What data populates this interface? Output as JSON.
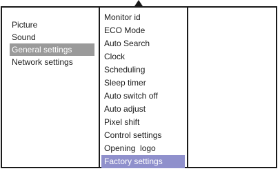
{
  "left_menu": {
    "items": [
      {
        "label": "Picture"
      },
      {
        "label": "Sound"
      },
      {
        "label": "General settings"
      },
      {
        "label": "Network settings"
      }
    ],
    "selected_index": 2
  },
  "right_menu": {
    "items": [
      {
        "label": "Monitor id"
      },
      {
        "label": "ECO Mode"
      },
      {
        "label": "Auto Search"
      },
      {
        "label": "Clock"
      },
      {
        "label": "Scheduling"
      },
      {
        "label": "Sleep timer"
      },
      {
        "label": "Auto switch off"
      },
      {
        "label": "Auto adjust"
      },
      {
        "label": "Pixel shift"
      },
      {
        "label": "Control settings"
      },
      {
        "label": "Opening  logo"
      },
      {
        "label": "Factory settings"
      }
    ],
    "selected_index": 11
  },
  "colors": {
    "left_highlight": "#9a9a9a",
    "right_highlight": "#8f90cc",
    "border": "#1a1a1a"
  },
  "icons": {
    "scroll_up": "up-arrow-icon"
  }
}
